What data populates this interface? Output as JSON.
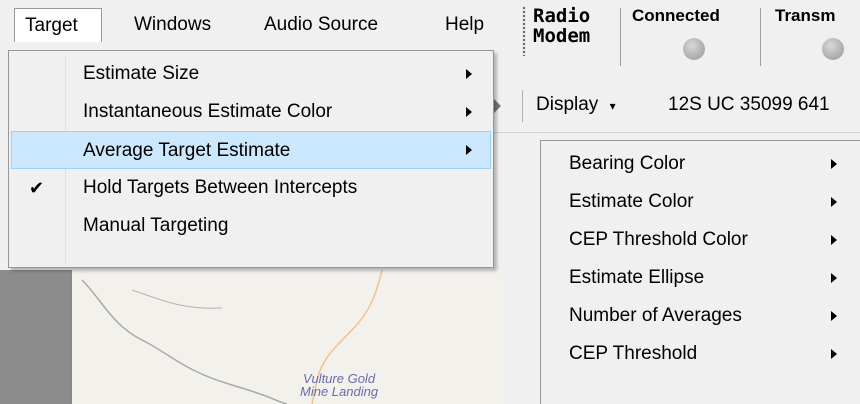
{
  "menubar": {
    "items": [
      {
        "label": "Target"
      },
      {
        "label": "Windows"
      },
      {
        "label": "Audio Source"
      },
      {
        "label": "Help"
      }
    ]
  },
  "radio_panel": {
    "title": "Radio\nModem",
    "statuses": [
      {
        "label": "Connected",
        "led_color": "#a9a9a9"
      },
      {
        "label": "Transm",
        "led_color": "#a9a9a9"
      }
    ]
  },
  "toolbar": {
    "display_label": "Display",
    "coordinates": "12S UC 35099 641"
  },
  "target_menu": {
    "items": [
      {
        "label": "Estimate Size",
        "has_submenu": true,
        "checked": false,
        "highlighted": false
      },
      {
        "label": "Instantaneous Estimate Color",
        "has_submenu": true,
        "checked": false,
        "highlighted": false
      },
      {
        "label": "Average Target Estimate",
        "has_submenu": true,
        "checked": false,
        "highlighted": true
      },
      {
        "label": "Hold Targets Between Intercepts",
        "has_submenu": false,
        "checked": true,
        "highlighted": false
      },
      {
        "label": "Manual Targeting",
        "has_submenu": false,
        "checked": false,
        "highlighted": false
      }
    ]
  },
  "average_submenu": {
    "items": [
      {
        "label": "Bearing Color"
      },
      {
        "label": "Estimate Color"
      },
      {
        "label": "CEP Threshold Color"
      },
      {
        "label": "Estimate Ellipse"
      },
      {
        "label": "Number of Averages"
      },
      {
        "label": "CEP Threshold"
      }
    ]
  },
  "map": {
    "label": "Vulture Gold\nMine Landing"
  },
  "colors": {
    "highlight_bg": "#cce8ff",
    "highlight_border": "#99d1ff",
    "menu_bg": "#f0f0f0"
  }
}
